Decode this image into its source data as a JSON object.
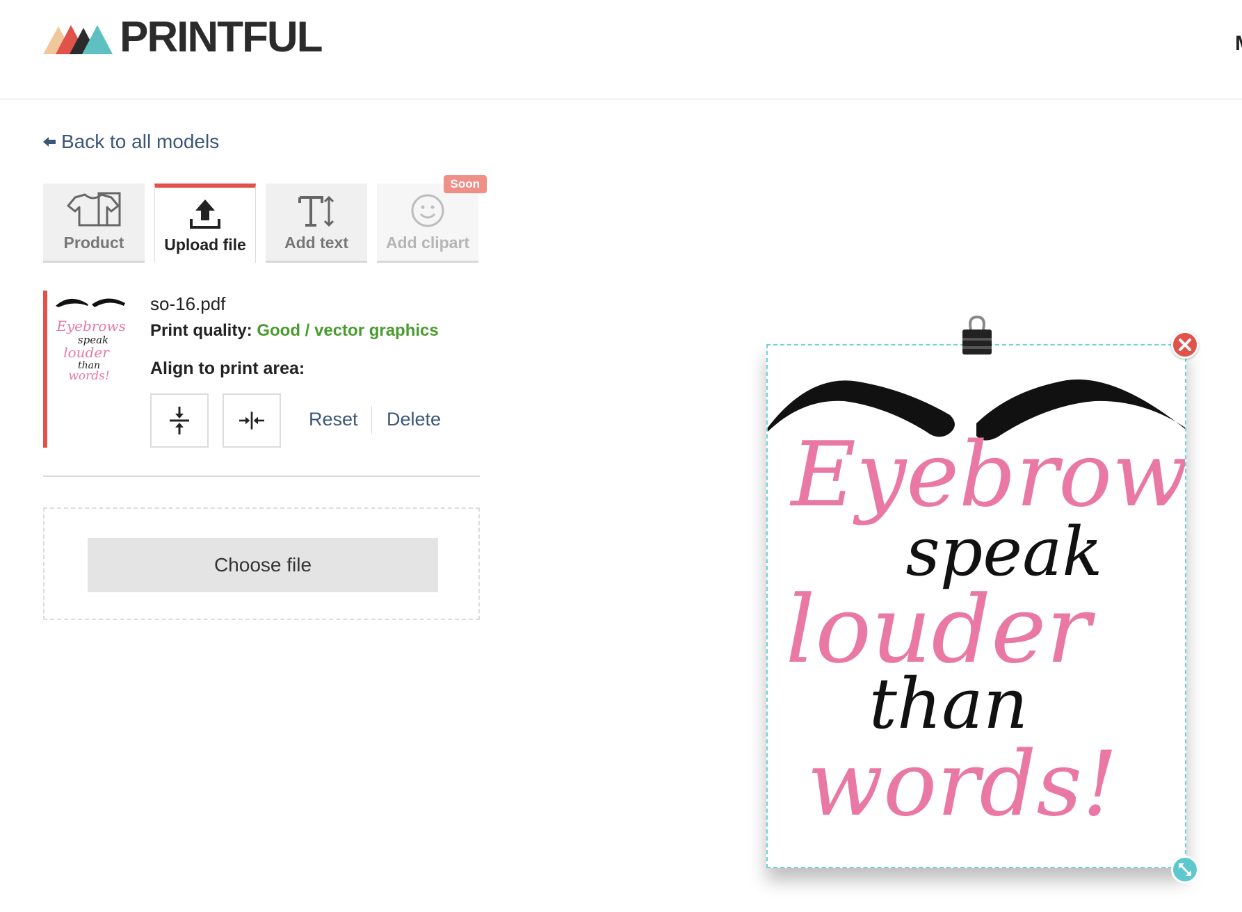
{
  "header": {
    "brand": "PRINTFUL",
    "cut_text": "M"
  },
  "nav": {
    "back_label": "Back to all models"
  },
  "tabs": [
    {
      "label": "Product",
      "icon": "tshirt-icon",
      "state": "normal"
    },
    {
      "label": "Upload file",
      "icon": "upload-icon",
      "state": "active"
    },
    {
      "label": "Add text",
      "icon": "text-icon",
      "state": "normal"
    },
    {
      "label": "Add clipart",
      "icon": "smiley-icon",
      "state": "disabled",
      "badge": "Soon"
    }
  ],
  "file": {
    "name": "so-16.pdf",
    "quality_label": "Print quality:",
    "quality_value": "Good / vector graphics",
    "align_label": "Align to print area:",
    "reset_label": "Reset",
    "delete_label": "Delete"
  },
  "dropzone": {
    "choose_label": "Choose file"
  },
  "artwork": {
    "lines": [
      "Eyebrows",
      "speak",
      "louder",
      "than",
      "words!"
    ]
  },
  "colors": {
    "accent": "#e0524a",
    "link": "#3a5677",
    "quality_good": "#4a9b2f",
    "pink": "#e979a4",
    "selection": "#6ed2d8"
  }
}
